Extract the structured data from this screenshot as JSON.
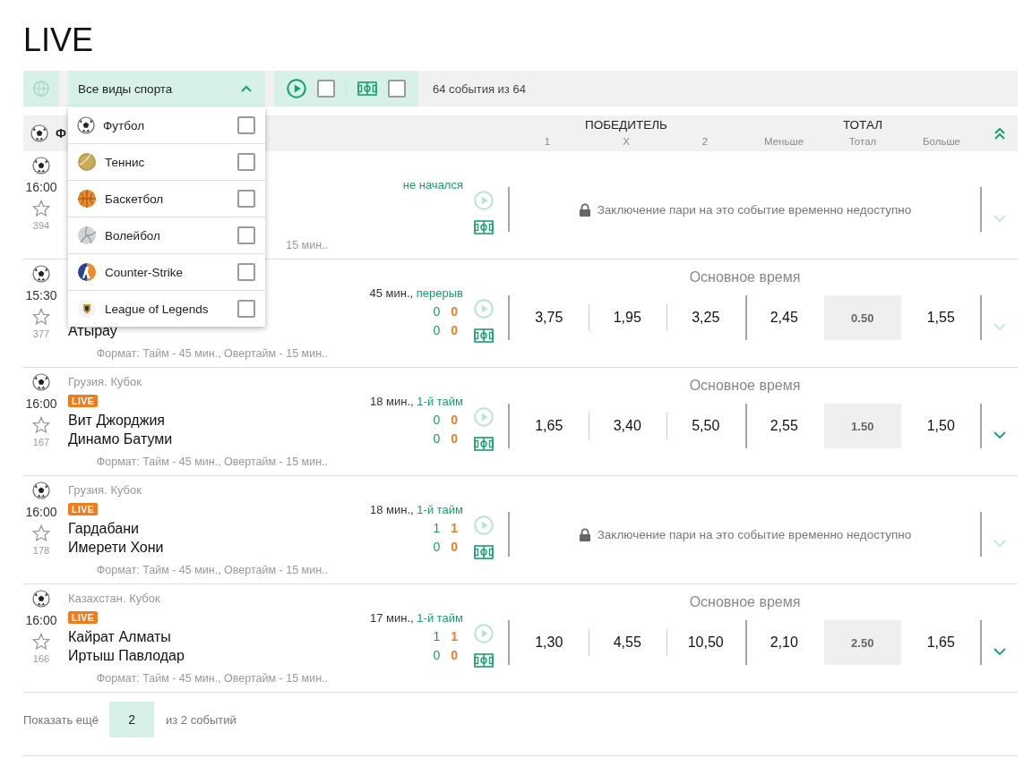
{
  "page": {
    "title": "LIVE"
  },
  "toolbar": {
    "sport_select": {
      "value": "Все виды спорта",
      "expanded": true
    },
    "filters": [
      {
        "kind": "video",
        "checked": false
      },
      {
        "kind": "pitch",
        "checked": false
      }
    ],
    "count": "64 события из 64"
  },
  "sport_menu": [
    {
      "label": "Футбол",
      "kind": "football",
      "checked": false
    },
    {
      "label": "Теннис",
      "kind": "tennis",
      "checked": false
    },
    {
      "label": "Баскетбол",
      "kind": "basketball",
      "checked": false
    },
    {
      "label": "Волейбол",
      "kind": "volleyball",
      "checked": false
    },
    {
      "label": "Counter-Strike",
      "kind": "shooter",
      "checked": false
    },
    {
      "label": "League of Legends",
      "kind": "moba",
      "checked": false
    }
  ],
  "group": {
    "title": "Ф",
    "collapsed": false,
    "columns": [
      {
        "title": "ПОБЕДИТЕЛЬ",
        "subs": [
          "1",
          "X",
          "2"
        ]
      },
      {
        "title": "ТОТАЛ",
        "subs": [
          "Меньше",
          "Тотал",
          "Больше"
        ]
      }
    ]
  },
  "events": [
    {
      "time": "16:00",
      "favorite": false,
      "favorites_count": "394",
      "status": {
        "phase": "не начался"
      },
      "format": "15 мин..",
      "market": {
        "kind": "locked",
        "message": "Заключение пари на это событие временно недоступно"
      },
      "expandable": false
    },
    {
      "time": "15:30",
      "favorite": false,
      "favorites_count": "377",
      "status": {
        "clock": "45 мин.,",
        "phase": "перерыв"
      },
      "teams": [
        "Атырау"
      ],
      "scores": [
        [
          "0",
          "0"
        ],
        [
          "0",
          "0"
        ]
      ],
      "format": "Формат: Тайм - 45 мин., Овертайм - 15 мин..",
      "market": {
        "kind": "odds",
        "label": "Основное время",
        "winner": [
          "3,75",
          "1,95",
          "3,25"
        ],
        "total": [
          "2,45",
          "0.50",
          "1,55"
        ]
      },
      "expandable": false
    },
    {
      "time": "16:00",
      "favorite": false,
      "favorites_count": "167",
      "league": "Грузия. Кубок",
      "badge": "LIVE",
      "status": {
        "clock": "18 мин.,",
        "phase": "1-й тайм"
      },
      "teams": [
        "Вит Джорджия",
        "Динамо Батуми"
      ],
      "scores": [
        [
          "0",
          "0"
        ],
        [
          "0",
          "0"
        ]
      ],
      "format": "Формат: Тайм - 45 мин., Овертайм - 15 мин..",
      "market": {
        "kind": "odds",
        "label": "Основное время",
        "winner": [
          "1,65",
          "3,40",
          "5,50"
        ],
        "total": [
          "2,55",
          "1.50",
          "1,50"
        ]
      },
      "expandable": true
    },
    {
      "time": "16:00",
      "favorite": false,
      "favorites_count": "178",
      "league": "Грузия. Кубок",
      "badge": "LIVE",
      "status": {
        "clock": "18 мин.,",
        "phase": "1-й тайм"
      },
      "teams": [
        "Гардабани",
        "Имерети Хони"
      ],
      "scores": [
        [
          "1",
          "1"
        ],
        [
          "0",
          "0"
        ]
      ],
      "format": "Формат: Тайм - 45 мин., Овертайм - 15 мин..",
      "market": {
        "kind": "locked",
        "message": "Заключение пари на это событие временно недоступно"
      },
      "expandable": false
    },
    {
      "time": "16:00",
      "favorite": false,
      "favorites_count": "166",
      "league": "Казахстан. Кубок",
      "badge": "LIVE",
      "status": {
        "clock": "17 мин.,",
        "phase": "1-й тайм"
      },
      "teams": [
        "Кайрат Алматы",
        "Иртыш Павлодар"
      ],
      "scores": [
        [
          "1",
          "1"
        ],
        [
          "0",
          "0"
        ]
      ],
      "format": "Формат: Тайм - 45 мин., Овертайм - 15 мин..",
      "market": {
        "kind": "odds",
        "label": "Основное время",
        "winner": [
          "1,30",
          "4,55",
          "10,50"
        ],
        "total": [
          "2,10",
          "2.50",
          "1,65"
        ]
      },
      "expandable": true
    }
  ],
  "footer": {
    "label": "Показать ещё",
    "value": "2",
    "suffix": "из 2 событий"
  }
}
